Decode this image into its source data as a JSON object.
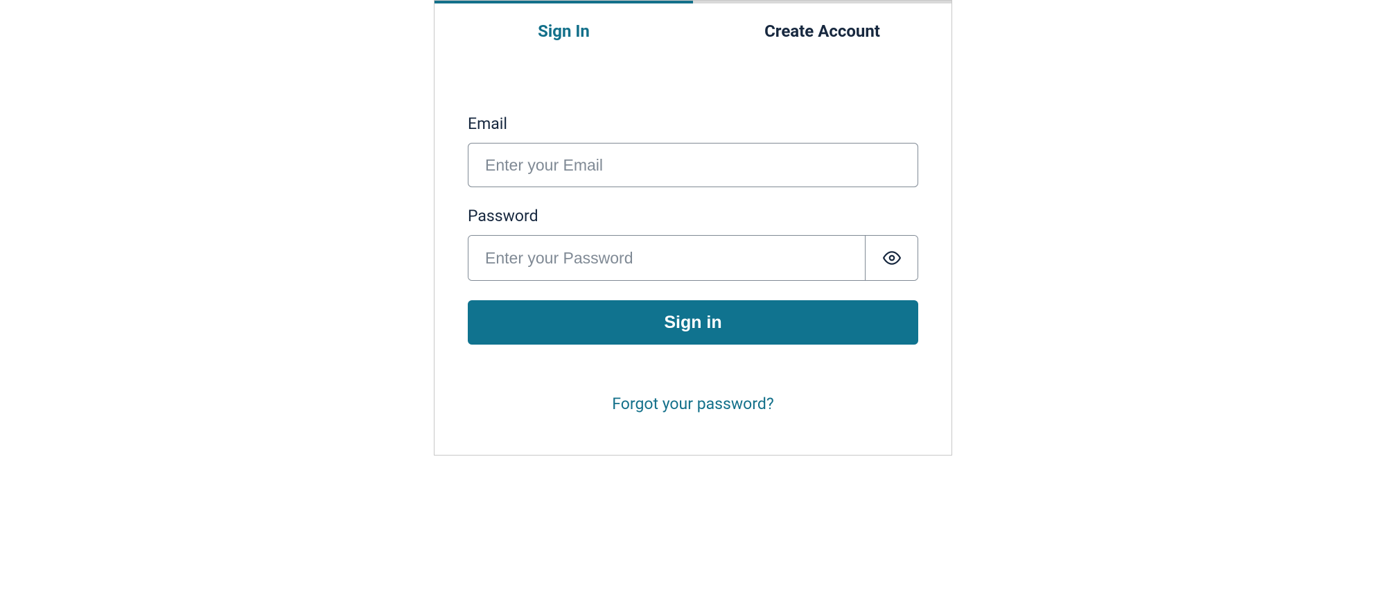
{
  "tabs": {
    "signin_label": "Sign In",
    "create_label": "Create Account"
  },
  "form": {
    "email_label": "Email",
    "email_placeholder": "Enter your Email",
    "email_value": "",
    "password_label": "Password",
    "password_placeholder": "Enter your Password",
    "password_value": "",
    "submit_label": "Sign in",
    "forgot_label": "Forgot your password?"
  },
  "colors": {
    "accent": "#10738f",
    "text_dark": "#17283f",
    "border": "#808a95"
  }
}
